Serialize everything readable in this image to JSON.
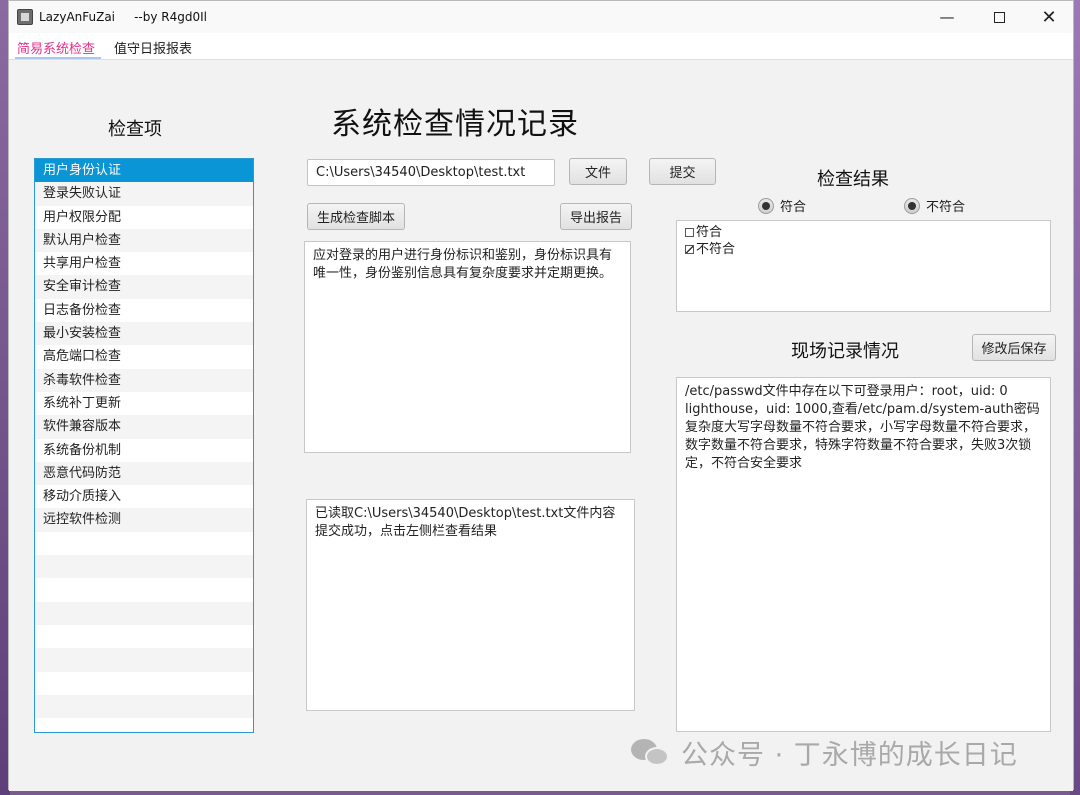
{
  "window": {
    "title": "LazyAnFuZai     --by R4gd0Il",
    "minimize_icon": "minimize-icon",
    "maximize_icon": "maximize-icon",
    "close_icon": "close-icon"
  },
  "menu": {
    "items": [
      "简易系统检查",
      "值守日报报表"
    ]
  },
  "left_panel": {
    "heading": "检查项",
    "items": [
      "用户身份认证",
      "登录失败认证",
      "用户权限分配",
      "默认用户检查",
      "共享用户检查",
      "安全审计检查",
      "日志备份检查",
      "最小安装检查",
      "高危端口检查",
      "杀毒软件检查",
      "系统补丁更新",
      "软件兼容版本",
      "系统备份机制",
      "恶意代码防范",
      "移动介质接入",
      "远控软件检测"
    ],
    "selected_index": 0
  },
  "main": {
    "title": "系统检查情况记录",
    "file_path": "C:\\Users\\34540\\Desktop\\test.txt",
    "file_button": "文件",
    "submit_button": "提交",
    "generate_script_button": "生成检查脚本",
    "export_report_button": "导出报告",
    "requirement_text": "应对登录的用户进行身份标识和鉴别，身份标识具有唯一性，身份鉴别信息具有复杂度要求并定期更换。",
    "log_text": "已读取C:\\Users\\34540\\Desktop\\test.txt文件内容\n提交成功，点击左侧栏查看结果"
  },
  "result": {
    "heading": "检查结果",
    "radio_conform": "符合",
    "radio_nonconform": "不符合",
    "options": [
      {
        "label": "符合",
        "checked": false
      },
      {
        "label": "不符合",
        "checked": true
      }
    ]
  },
  "record": {
    "heading": "现场记录情况",
    "save_button": "修改后保存",
    "text": "/etc/passwd文件中存在以下可登录用户：root，uid: 0\nlighthouse，uid: 1000,查看/etc/pam.d/system-auth密码复杂度大写字母数量不符合要求，小写字母数量不符合要求，数字数量不符合要求，特殊字符数量不符合要求，失败3次锁定，不符合安全要求"
  },
  "watermark": {
    "text": "公众号 · 丁永博的成长日记",
    "icon": "wechat-icon"
  },
  "colors": {
    "selected_row": "#0a96d6",
    "active_menu": "#e5308a"
  }
}
